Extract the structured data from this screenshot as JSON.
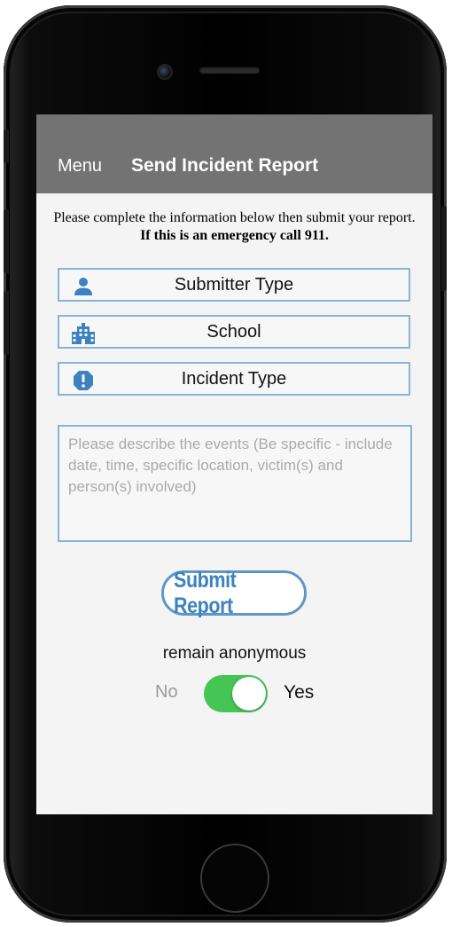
{
  "nav": {
    "menu_label": "Menu",
    "title": "Send Incident Report"
  },
  "intro": {
    "text": "Please complete the information below then submit your report. ",
    "emphasis": "If this is an emergency call 911."
  },
  "fields": [
    {
      "label": "Submitter Type",
      "icon": "person-icon"
    },
    {
      "label": "School",
      "icon": "building-icon"
    },
    {
      "label": "Incident Type",
      "icon": "alert-icon"
    }
  ],
  "description": {
    "value": "",
    "placeholder": "Please describe the events (Be specific - include date, time, specific location, victim(s) and person(s) involved)"
  },
  "submit": {
    "label": "Submit Report"
  },
  "anonymous": {
    "label": "remain anonymous",
    "off_label": "No",
    "on_label": "Yes",
    "enabled": true
  },
  "colors": {
    "navbar": "#737373",
    "field_border": "#89b3d6",
    "icon": "#3d82c0",
    "toggle_on": "#44c554",
    "submit_text": "#3d82c0"
  }
}
